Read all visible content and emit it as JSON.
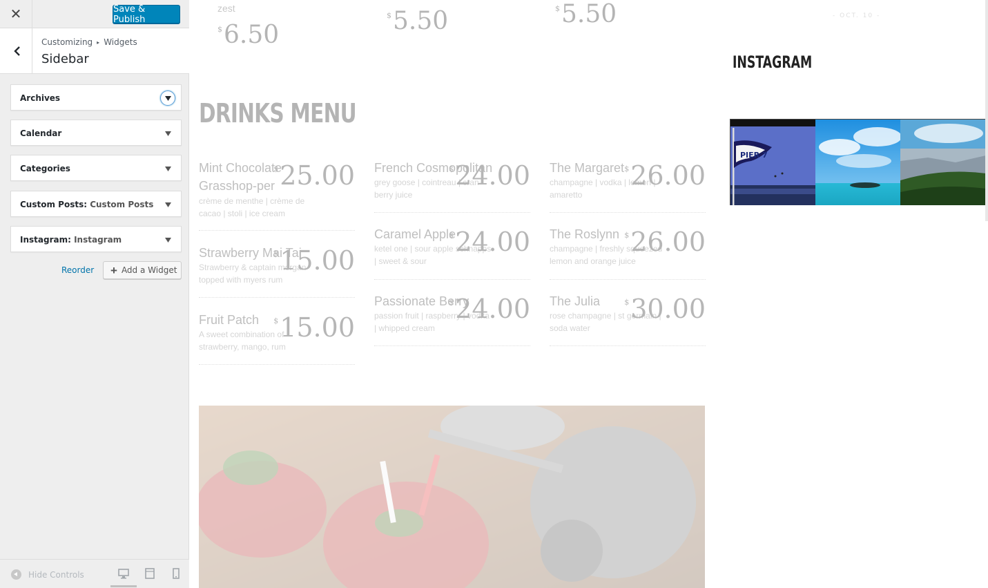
{
  "customizer": {
    "close_label": "✕",
    "publish_label": "Save & Publish",
    "breadcrumb": [
      "Customizing",
      "Widgets"
    ],
    "breadcrumb_sep": "▸",
    "section_title": "Sidebar",
    "widgets": [
      {
        "title": "Archives",
        "subtitle": ""
      },
      {
        "title": "Calendar",
        "subtitle": ""
      },
      {
        "title": "Categories",
        "subtitle": ""
      },
      {
        "title": "Custom Posts:",
        "subtitle": "Custom Posts"
      },
      {
        "title": "Instagram:",
        "subtitle": "Instagram"
      }
    ],
    "reorder_label": "Reorder",
    "add_widget_label": "Add a Widget",
    "hide_controls_label": "Hide Controls"
  },
  "preview": {
    "top_partial": {
      "zest": "zest",
      "prices": [
        "6.50",
        "5.50",
        "5.50"
      ],
      "dollar": "$"
    },
    "oct_label": "- OCT. 10 -",
    "drinks_menu_title": "DRINKS MENU",
    "instagram_title": "INSTAGRAM",
    "drinks": [
      {
        "name": "Mint Chocolate Grasshop-per",
        "desc": "crème de menthe | crème de cacao | stoli | ice cream",
        "price": "25.00"
      },
      {
        "name": "French Cosmopolitan",
        "desc": "grey goose | cointreau | cran-berry juice",
        "price": "24.00"
      },
      {
        "name": "The Margaret",
        "desc": "champagne | vodka | lemon | amaretto",
        "price": "26.00"
      },
      {
        "name": "Strawberry Mai Tai",
        "desc": "Strawberry & captain morgan topped with myers rum",
        "price": "15.00"
      },
      {
        "name": "Caramel Apple",
        "desc": "ketel one | sour apple schnapps | sweet & sour",
        "price": "24.00"
      },
      {
        "name": "The Roslynn",
        "desc": "champagne | freshly squeezed lemon and orange juice",
        "price": "26.00"
      },
      {
        "name": "Fruit Patch",
        "desc": "A sweet combination of strawberry, mango, rum",
        "price": "15.00"
      },
      {
        "name": "Passionate Berry",
        "desc": "passion fruit | raspberry | vodka | whipped cream",
        "price": "24.00"
      },
      {
        "name": "The Julia",
        "desc": "rose champagne | st germain | soda water",
        "price": "30.00"
      }
    ],
    "instagram_photos": [
      {
        "alt": "flag-and-bay-photo",
        "flag_text": "PIER 7"
      },
      {
        "alt": "tropical-island-photo"
      },
      {
        "alt": "coastal-city-photo"
      }
    ]
  },
  "colors": {
    "publish_blue": "#0085ba",
    "link_blue": "#0073aa",
    "panel_bg": "#eeeeee"
  }
}
